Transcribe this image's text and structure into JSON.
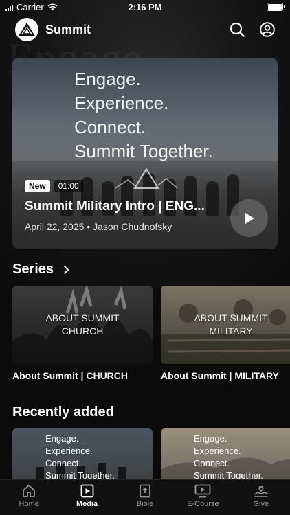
{
  "status_bar": {
    "carrier": "Carrier",
    "time": "2:16 PM",
    "battery_level": 1.0
  },
  "header": {
    "app_name": "Summit"
  },
  "hero": {
    "overlay_lines": [
      "Engage.",
      "Experience.",
      "Connect.",
      "Summit Together."
    ],
    "badge_new": "New",
    "duration": "01:00",
    "title": "Summit Military Intro | ENG...",
    "date": "April 22, 2025",
    "separator": "•",
    "author": "Jason Chudnofsky"
  },
  "series": {
    "title": "Series",
    "items": [
      {
        "overlay": "ABOUT SUMMIT\nCHURCH",
        "overlay_l1": "ABOUT SUMMIT",
        "overlay_l2": "CHURCH",
        "label": "About Summit | CHURCH"
      },
      {
        "overlay_l1": "ABOUT SUMMIT",
        "overlay_l2": "MILITARY",
        "label": "About Summit | MILITARY"
      }
    ]
  },
  "recent": {
    "title": "Recently added",
    "items": [
      {
        "lines": [
          "Engage.",
          "Experience.",
          "Connect.",
          "Summit Together."
        ]
      },
      {
        "lines": [
          "Engage.",
          "Experience.",
          "Connect.",
          "Summit Together."
        ]
      }
    ]
  },
  "tabbar": {
    "tabs": [
      {
        "label": "Home",
        "icon": "home-icon",
        "active": false
      },
      {
        "label": "Media",
        "icon": "media-icon",
        "active": true
      },
      {
        "label": "Bible",
        "icon": "bible-icon",
        "active": false
      },
      {
        "label": "E-Course",
        "icon": "ecourse-icon",
        "active": false
      },
      {
        "label": "Give",
        "icon": "give-icon",
        "active": false
      }
    ]
  },
  "colors": {
    "background": "#0b0b0b",
    "tab_active": "#ffffff",
    "tab_inactive": "#9a9a9a"
  }
}
